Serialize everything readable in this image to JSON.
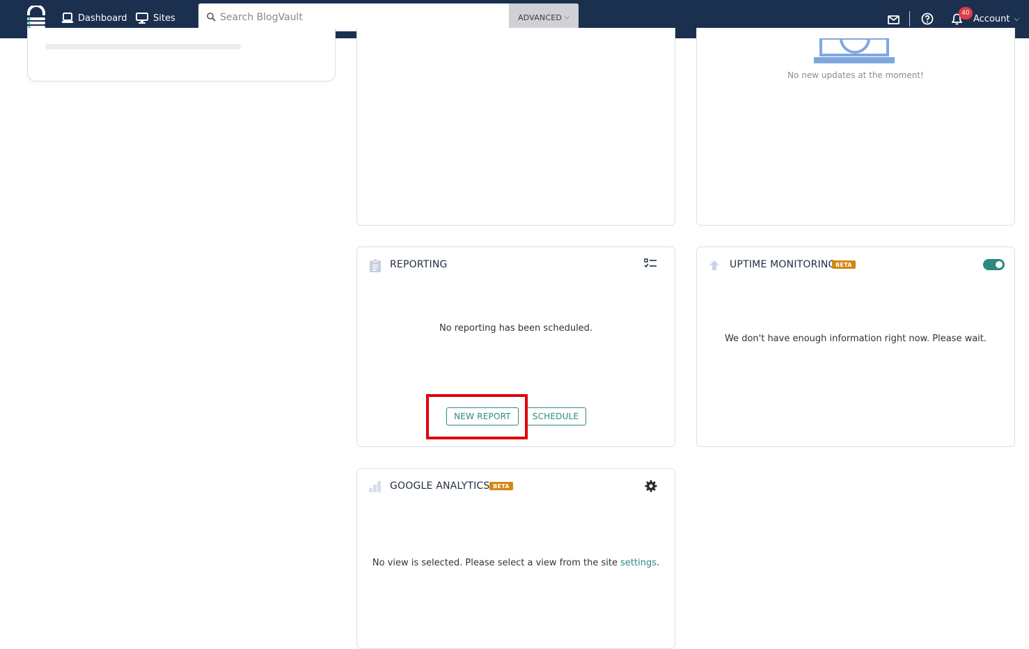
{
  "nav": {
    "dashboard_label": "Dashboard",
    "sites_label": "Sites"
  },
  "search": {
    "placeholder": "Search BlogVault",
    "advanced_label": "ADVANCED"
  },
  "notifications": {
    "count": "40"
  },
  "account": {
    "label": "Account"
  },
  "updates_card": {
    "message": "No new updates at the moment!"
  },
  "reporting": {
    "title": "REPORTING",
    "message": "No reporting has been scheduled.",
    "new_report_label": "NEW REPORT",
    "schedule_label": "SCHEDULE"
  },
  "uptime": {
    "title": "UPTIME MONITORING",
    "badge": "BETA",
    "message": "We don't have enough information right now. Please wait.",
    "enabled": true
  },
  "google_analytics": {
    "title": "GOOGLE ANALYTICS",
    "badge": "BETA",
    "message_prefix": "No view is selected. Please select a view from the site",
    "settings_link": "settings",
    "message_suffix": "."
  },
  "colors": {
    "topbar": "#1b2f4f",
    "accent": "#2a8a7e",
    "beta": "#d58512",
    "badge": "#e03b4b",
    "highlight": "#e0000c"
  }
}
